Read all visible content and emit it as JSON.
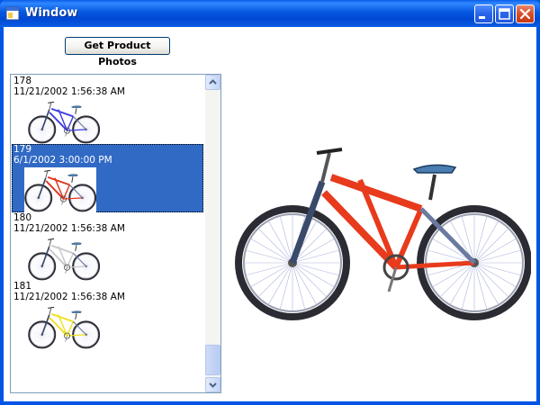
{
  "window": {
    "title": "Window"
  },
  "toolbar": {
    "get_photos_label": "Get Product Photos"
  },
  "products": [
    {
      "id": "178",
      "date": "11/21/2002 1:56:38 AM",
      "frame_color": "#3e3ee0",
      "selected": false
    },
    {
      "id": "179",
      "date": "6/1/2002 3:00:00 PM",
      "frame_color": "#e0341c",
      "selected": true
    },
    {
      "id": "180",
      "date": "11/21/2002 1:56:38 AM",
      "frame_color": "#c8c8c8",
      "selected": false
    },
    {
      "id": "181",
      "date": "11/21/2002 1:56:38 AM",
      "frame_color": "#f0e020",
      "selected": false
    }
  ],
  "preview": {
    "frame_color": "#e83a1c"
  },
  "colors": {
    "title_bar": "#0055e5",
    "selection": "#316ac5",
    "close_button": "#d44a25"
  },
  "icons": {
    "app": "window-app-icon",
    "minimize": "minimize-icon",
    "maximize": "maximize-icon",
    "close": "close-icon",
    "scroll_up": "chevron-up-icon",
    "scroll_down": "chevron-down-icon"
  }
}
